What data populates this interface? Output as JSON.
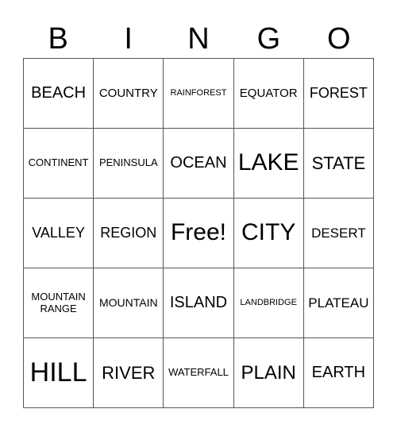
{
  "header": [
    "B",
    "I",
    "N",
    "G",
    "O"
  ],
  "cells": [
    [
      "BEACH",
      "COUNTRY",
      "RAINFOREST",
      "EQUATOR",
      "FOREST"
    ],
    [
      "CONTINENT",
      "PENINSULA",
      "OCEAN",
      "LAKE",
      "STATE"
    ],
    [
      "VALLEY",
      "REGION",
      "Free!",
      "CITY",
      "DESERT"
    ],
    [
      "MOUNTAIN RANGE",
      "MOUNTAIN",
      "ISLAND",
      "LANDBRIDGE",
      "PLATEAU"
    ],
    [
      "HILL",
      "RIVER",
      "WATERFALL",
      "PLAIN",
      "EARTH"
    ]
  ]
}
